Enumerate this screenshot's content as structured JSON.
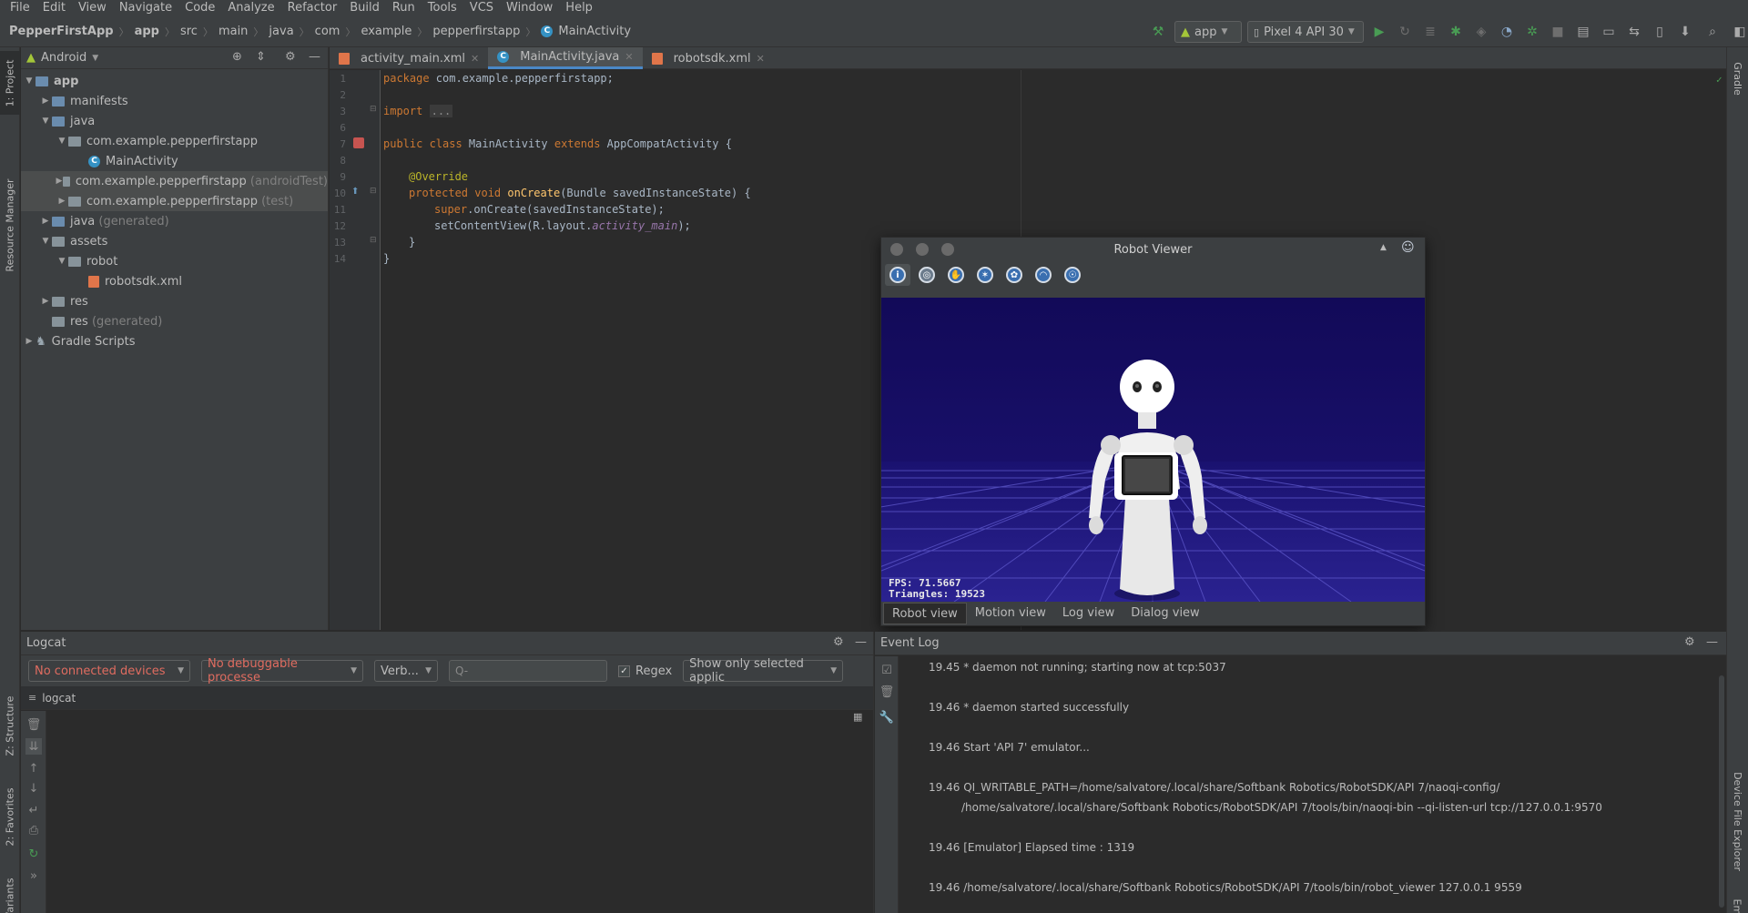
{
  "menu": [
    "File",
    "Edit",
    "View",
    "Navigate",
    "Code",
    "Analyze",
    "Refactor",
    "Build",
    "Run",
    "Tools",
    "VCS",
    "Window",
    "Help"
  ],
  "breadcrumb": [
    "PepperFirstApp",
    "app",
    "src",
    "main",
    "java",
    "com",
    "example",
    "pepperfirstapp",
    "MainActivity"
  ],
  "toolbar": {
    "run_config": "app",
    "device": "Pixel 4 API 30"
  },
  "left_stripe": {
    "project": "1: Project",
    "resource_manager": "Resource Manager",
    "structure": "Z: Structure",
    "favorites": "2: Favorites",
    "build_variants": "Build Variants"
  },
  "right_stripe": {
    "gradle": "Gradle",
    "device_file_explorer": "Device File Explorer",
    "emulator": "Emulator"
  },
  "project": {
    "view": "Android",
    "tree": [
      {
        "label": "app",
        "suffix": ""
      },
      {
        "label": "manifests",
        "suffix": ""
      },
      {
        "label": "java",
        "suffix": ""
      },
      {
        "label": "com.example.pepperfirstapp",
        "suffix": ""
      },
      {
        "label": "MainActivity",
        "suffix": ""
      },
      {
        "label": "com.example.pepperfirstapp",
        "suffix": "(androidTest)"
      },
      {
        "label": "com.example.pepperfirstapp",
        "suffix": "(test)"
      },
      {
        "label": "java",
        "suffix": "(generated)"
      },
      {
        "label": "assets",
        "suffix": ""
      },
      {
        "label": "robot",
        "suffix": ""
      },
      {
        "label": "robotsdk.xml",
        "suffix": ""
      },
      {
        "label": "res",
        "suffix": ""
      },
      {
        "label": "res",
        "suffix": "(generated)"
      },
      {
        "label": "Gradle Scripts",
        "suffix": ""
      }
    ]
  },
  "editor": {
    "tabs": [
      "activity_main.xml",
      "MainActivity.java",
      "robotsdk.xml"
    ],
    "line_numbers": [
      "1",
      "2",
      "3",
      "6",
      "7",
      "8",
      "9",
      "10",
      "11",
      "12",
      "13",
      "14"
    ],
    "code": {
      "l1a": "package",
      "l1b": " com.example.pepperfirstapp;",
      "l3a": "import",
      "l3b": "...",
      "l7a": "public class",
      "l7b": " MainActivity ",
      "l7c": "extends",
      "l7d": " AppCompatActivity {",
      "l9": "@Override",
      "l10a": "protected void",
      "l10b": "onCreate",
      "l10c": "(Bundle savedInstanceState) {",
      "l11a": "super",
      "l11b": ".onCreate(savedInstanceState);",
      "l12a": "setContentView(R.layout.",
      "l12b": "activity_main",
      "l12c": ");",
      "l13": "}",
      "l14": "}"
    }
  },
  "robot_viewer": {
    "title": "Robot Viewer",
    "fps": "FPS: 71.5667",
    "triangles": "Triangles: 19523",
    "tabs": [
      "Robot view",
      "Motion view",
      "Log view",
      "Dialog view"
    ]
  },
  "logcat": {
    "title": "Logcat",
    "devices": "No connected devices",
    "process": "No debuggable processe",
    "level": "Verb...",
    "search_placeholder": "Q-",
    "regex": "Regex",
    "filter": "Show only selected applic",
    "log_label": "logcat"
  },
  "event_log": {
    "title": "Event Log",
    "entries": [
      {
        "time": "19.45",
        "text": "* daemon not running; starting now at tcp:5037"
      },
      {
        "time": "19.46",
        "text": "* daemon started successfully"
      },
      {
        "time": "19.46",
        "text": "Start 'API 7' emulator..."
      },
      {
        "time": "19.46",
        "text": "QI_WRITABLE_PATH=/home/salvatore/.local/share/Softbank Robotics/RobotSDK/API 7/naoqi-config/"
      },
      {
        "time": "",
        "text": "/home/salvatore/.local/share/Softbank Robotics/RobotSDK/API 7/tools/bin/naoqi-bin --qi-listen-url tcp://127.0.0.1:9570"
      },
      {
        "time": "19.46",
        "text": "[Emulator] Elapsed time : 1319"
      },
      {
        "time": "19.46",
        "text": "/home/salvatore/.local/share/Softbank Robotics/RobotSDK/API 7/tools/bin/robot_viewer 127.0.0.1 9559"
      }
    ]
  },
  "colors": {
    "accent": "#4a88c7",
    "error": "#e06c60",
    "run": "#499c54",
    "viewer_bg": "#150a5c"
  }
}
